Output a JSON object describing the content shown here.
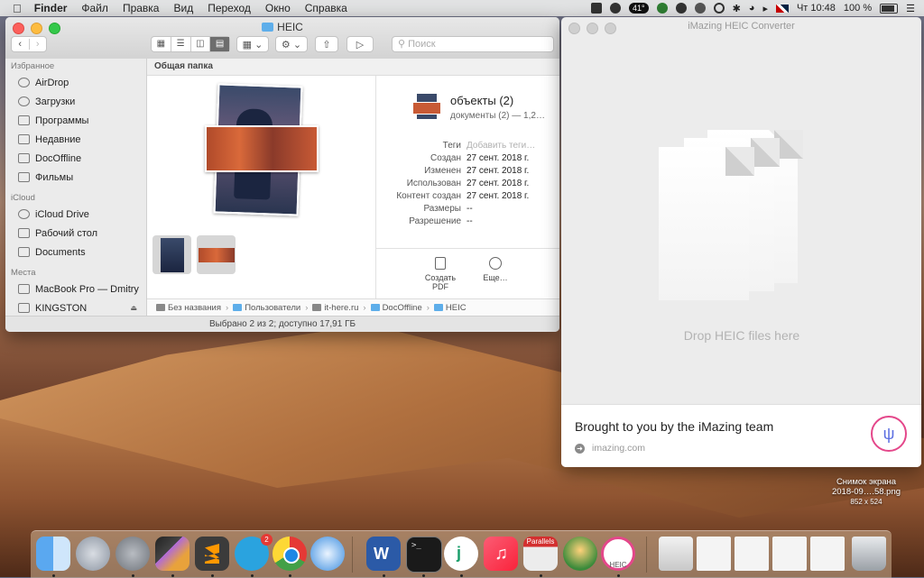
{
  "menubar": {
    "app": "Finder",
    "items": [
      "Файл",
      "Правка",
      "Вид",
      "Переход",
      "Окно",
      "Справка"
    ],
    "temp_badge": "41°",
    "clock": "Чт 10:48",
    "battery": "100 %"
  },
  "finder": {
    "title": "HEIC",
    "search_placeholder": "Поиск",
    "sidebar": {
      "favorites_header": "Избранное",
      "favorites": [
        "AirDrop",
        "Загрузки",
        "Программы",
        "Недавние",
        "DocOffline",
        "Фильмы"
      ],
      "icloud_header": "iCloud",
      "icloud": [
        "iCloud Drive",
        "Рабочий стол",
        "Documents"
      ],
      "places_header": "Места",
      "places": [
        "MacBook Pro — Dmitry",
        "KINGSTON"
      ]
    },
    "content_header": "Общая папка",
    "info": {
      "title": "объекты (2)",
      "subtitle": "документы (2) — 1,2…",
      "rows": [
        {
          "k": "Теги",
          "v": "Добавить теги…"
        },
        {
          "k": "Создан",
          "v": "27 сент. 2018 г."
        },
        {
          "k": "Изменен",
          "v": "27 сент. 2018 г."
        },
        {
          "k": "Использован",
          "v": "27 сент. 2018 г."
        },
        {
          "k": "Контент создан",
          "v": "27 сент. 2018 г."
        },
        {
          "k": "Размеры",
          "v": "--"
        },
        {
          "k": "Разрешение",
          "v": "--"
        }
      ],
      "actions": {
        "create_pdf": "Создать PDF",
        "more": "Еще…"
      }
    },
    "path": [
      "Без названия",
      "Пользователи",
      "it-here.ru",
      "DocOffline",
      "HEIC"
    ],
    "status": "Выбрано 2 из 2; доступно 17,91 ГБ"
  },
  "imazing": {
    "title": "iMazing HEIC Converter",
    "drop_text": "Drop HEIC files here",
    "footer_title": "Brought to you by the iMazing team",
    "footer_link": "imazing.com"
  },
  "screenshot_label": {
    "line1": "Снимок экрана",
    "line2": "2018-09….58.png",
    "dims": "852 x 524"
  },
  "dock": {
    "telegram_badge": "2",
    "parallels_label": "Parallels",
    "heic_label": "HEIC"
  }
}
